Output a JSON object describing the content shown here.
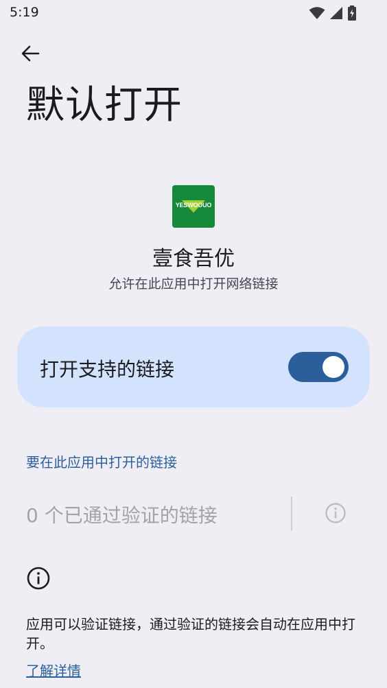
{
  "status_bar": {
    "time": "5:19",
    "icons": [
      "wifi-icon",
      "cellular-signal-icon",
      "battery-charging-icon"
    ]
  },
  "header": {
    "back_icon": "arrow-back-icon",
    "title": "默认打开"
  },
  "app": {
    "icon_text": "YESWOOUO",
    "name": "壹食吾优",
    "subtitle": "允许在此应用中打开网络链接"
  },
  "toggle": {
    "label": "打开支持的链接",
    "enabled": true
  },
  "links_section": {
    "header": "要在此应用中打开的链接",
    "verified_links": "0 个已通过验证的链接",
    "info_icon": "info-icon"
  },
  "footer": {
    "info_icon": "info-icon",
    "text": "应用可以验证链接，通过验证的链接会自动在应用中打开。",
    "learn_more": "了解详情"
  },
  "colors": {
    "background": "#f0eef5",
    "card": "#d3e3fd",
    "accent": "#2b5f9b",
    "app_icon_bg": "#168a3a",
    "disabled_text": "#a3a3a8"
  }
}
